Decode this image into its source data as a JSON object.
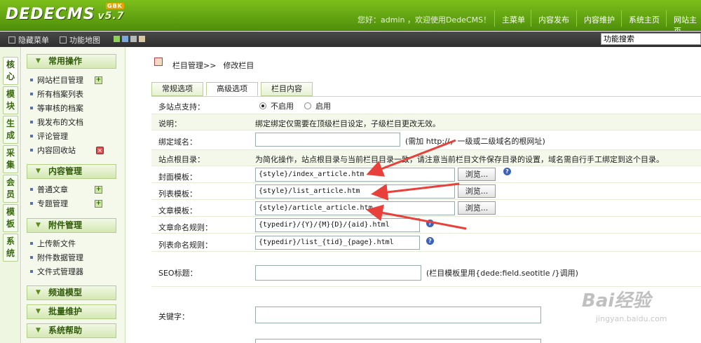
{
  "header": {
    "logo": "DEDECMS",
    "version": "v5.7",
    "badge": "GBK",
    "welcome": "您好：admin ，欢迎使用DedeCMS！",
    "nav": [
      "主菜单",
      "内容发布",
      "内容维护",
      "系统主页",
      "网站主页"
    ]
  },
  "toolbar": {
    "hide_menu": "隐藏菜单",
    "function_map": "功能地图",
    "search_placeholder": "功能搜索",
    "skin_colors": [
      "#8fd15a",
      "#7aa8d8",
      "#b7b7b7",
      "#d8c7a0"
    ]
  },
  "vertical_tabs": [
    "核心",
    "模块",
    "生成",
    "采集",
    "会员",
    "模板",
    "系统"
  ],
  "left_menu": {
    "groups": [
      {
        "title": "常用操作",
        "items": [
          "网站栏目管理",
          "所有档案列表",
          "等审核的档案",
          "我发布的文档",
          "评论管理",
          "内容回收站"
        ]
      },
      {
        "title": "内容管理",
        "items": [
          "普通文章",
          "专题管理"
        ]
      },
      {
        "title": "附件管理",
        "items": [
          "上传新文件",
          "附件数据管理",
          "文件式管理器"
        ]
      },
      {
        "title": "频道模型",
        "items": []
      },
      {
        "title": "批量维护",
        "items": []
      },
      {
        "title": "系统帮助",
        "items": []
      }
    ]
  },
  "breadcrumb": {
    "link": "栏目管理",
    "sep": ">>",
    "current": "修改栏目"
  },
  "tabs": [
    "常规选项",
    "高级选项",
    "栏目内容"
  ],
  "form": {
    "multisite_label": "多站点支持：",
    "multisite_off": "不启用",
    "multisite_on": "启用",
    "note_label": "说明：",
    "note_text": "绑定绑定仅需要在顶级栏目设定，子级栏目更改无效。",
    "domain_label": "绑定域名：",
    "domain_value": "",
    "domain_hint": "(需加 http://，一级或二级域名的根网址)",
    "root_label": "站点根目录：",
    "root_text": "为简化操作，站点根目录与当前栏目目录一致，请注意当前栏目文件保存目录的设置，域名需自行手工绑定到这个目录。",
    "cover_label": "封面模板：",
    "cover_value": "{style}/index_article.htm",
    "list_label": "列表模板：",
    "list_value": "{style}/list_article.htm",
    "article_label": "文章模板：",
    "article_value": "{style}/article_article.htm",
    "browse": "浏览...",
    "article_rule_label": "文章命名规则：",
    "article_rule_value": "{typedir}/{Y}/{M}{D}/{aid}.html",
    "list_rule_label": "列表命名规则：",
    "list_rule_value": "{typedir}/list_{tid}_{page}.html",
    "seo_label": "SEO标题：",
    "seo_value": "",
    "seo_hint": "(栏目模板里用{dede:field.seotitle /}调用)",
    "keywords_label": "关键字：",
    "keywords_value": ""
  },
  "watermark": {
    "brand": "Bai经验",
    "url": "jingyan.baidu.com"
  },
  "accent_color": "#e8403a"
}
